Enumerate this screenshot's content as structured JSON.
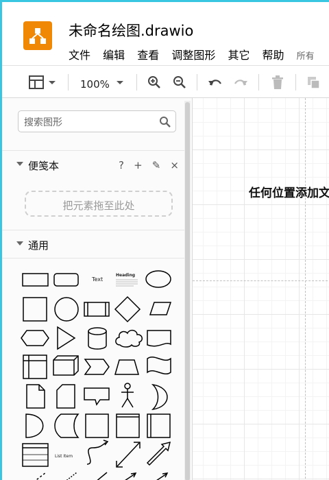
{
  "app": {
    "title": "未命名绘图.drawio",
    "menu": [
      "文件",
      "编辑",
      "查看",
      "调整图形",
      "其它",
      "帮助",
      "所有"
    ]
  },
  "toolbar": {
    "zoom": "100%"
  },
  "sidebar": {
    "search_placeholder": "搜索图形",
    "scratchpad": {
      "title": "便笺本",
      "tools": [
        "?",
        "+",
        "✎",
        "×"
      ],
      "drop_hint": "把元素拖至此处"
    },
    "general": {
      "title": "通用",
      "text_shape_label": "Text",
      "heading_shape_label": "Heading",
      "list_item_label": "List Item"
    }
  },
  "canvas": {
    "hint": "任何位置添加文"
  },
  "colors": {
    "frame": "#38c6e0",
    "logo": "#f08705"
  }
}
